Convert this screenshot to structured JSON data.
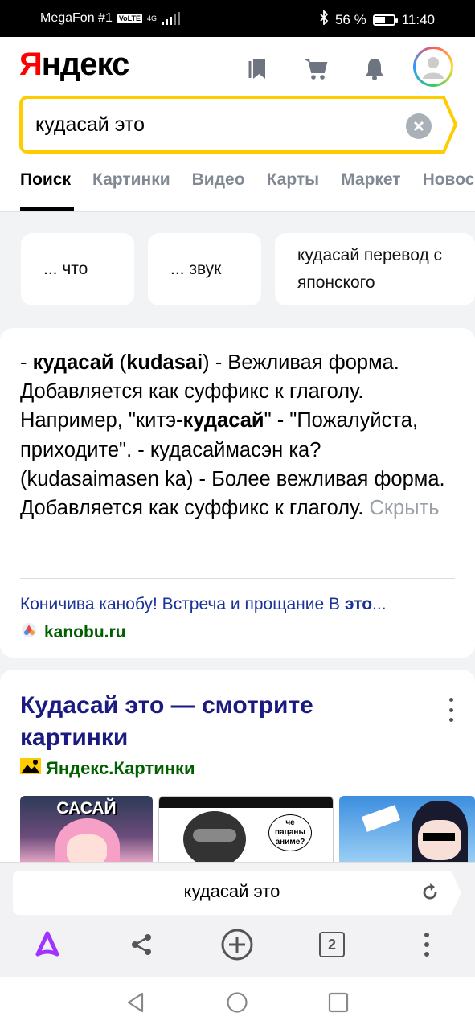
{
  "status_bar": {
    "carrier": "MegaFon #1",
    "volte": "VoLTE",
    "network": "4G",
    "battery_text": "56 %",
    "battery_level": 0.56,
    "time": "11:40"
  },
  "header": {
    "logo": "Яндекс",
    "icons": [
      "bookmark-icon",
      "cart-icon",
      "bell-icon",
      "avatar"
    ]
  },
  "search": {
    "query": "кудасай это"
  },
  "tabs": [
    "Поиск",
    "Картинки",
    "Видео",
    "Карты",
    "Маркет",
    "Новости"
  ],
  "active_tab": "Поиск",
  "suggestions": [
    "... что",
    "... звук",
    "кудасай перевод с японского"
  ],
  "snippet": {
    "part1": "- ",
    "bold1": "кудасай",
    "part2": " (",
    "bold2": "kudasai",
    "part3": ") - Вежливая форма. Добавляется как суффикс к глаголу. Например, \"китэ-",
    "bold3": "кудасай",
    "part4": "\" - \"Пожалуйста, приходите\". - кудасаймасэн ка? (kudasaimasen ka) - Более вежливая форма. Добавляется как суффикс к глаголу.",
    "hide_link": "Скрыть",
    "source_title": "Коничива канобу! Встреча и прощание В ",
    "source_title_bold": "это",
    "source_title_ellipsis": "...",
    "source_domain": "kanobu.ru"
  },
  "images_block": {
    "title": "Кудасай это — смотрите картинки",
    "source": "Яндекс.Картинки",
    "thumb_texts": [
      "САСАЙ",
      "че пацаны аниме?"
    ]
  },
  "omnibox": {
    "query": "кудасай это"
  },
  "toolbar": {
    "tabs_count": "2"
  },
  "colors": {
    "yandex_red": "#ff0000",
    "search_border": "#ffcc00",
    "link_blue": "#1a3399",
    "domain_green": "#006000",
    "alice_purple": "#a033ff"
  }
}
